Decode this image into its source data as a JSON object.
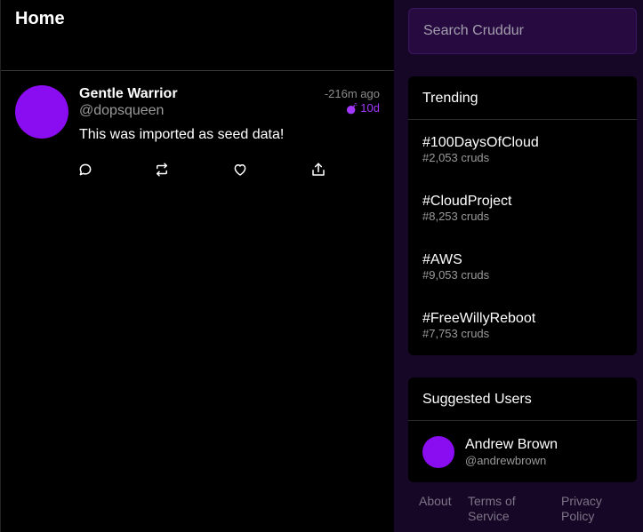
{
  "feed": {
    "title": "Home",
    "posts": [
      {
        "display_name": "Gentle Warrior",
        "handle": "@dopsqueen",
        "message": "This was imported as seed data!",
        "time_ago": "-216m ago",
        "expires": "10d",
        "expires_icon": "bomb-icon",
        "actions": [
          "reply-icon",
          "repost-icon",
          "like-icon",
          "share-icon"
        ]
      }
    ]
  },
  "sidebar": {
    "search": {
      "placeholder": "Search Cruddur",
      "value": ""
    },
    "trending": {
      "title": "Trending",
      "items": [
        {
          "tag": "#100DaysOfCloud",
          "count": "#2,053 cruds"
        },
        {
          "tag": "#CloudProject",
          "count": "#8,253 cruds"
        },
        {
          "tag": "#AWS",
          "count": "#9,053 cruds"
        },
        {
          "tag": "#FreeWillyReboot",
          "count": "#7,753 cruds"
        }
      ]
    },
    "suggested": {
      "title": "Suggested Users",
      "users": [
        {
          "name": "Andrew Brown",
          "handle": "@andrewbrown"
        }
      ]
    },
    "footer": {
      "about": "About",
      "terms": "Terms of Service",
      "privacy": "Privacy Policy"
    }
  },
  "colors": {
    "accent": "#8a0cf0",
    "sidebar_bg": "#170726",
    "search_bg": "#270a40"
  }
}
